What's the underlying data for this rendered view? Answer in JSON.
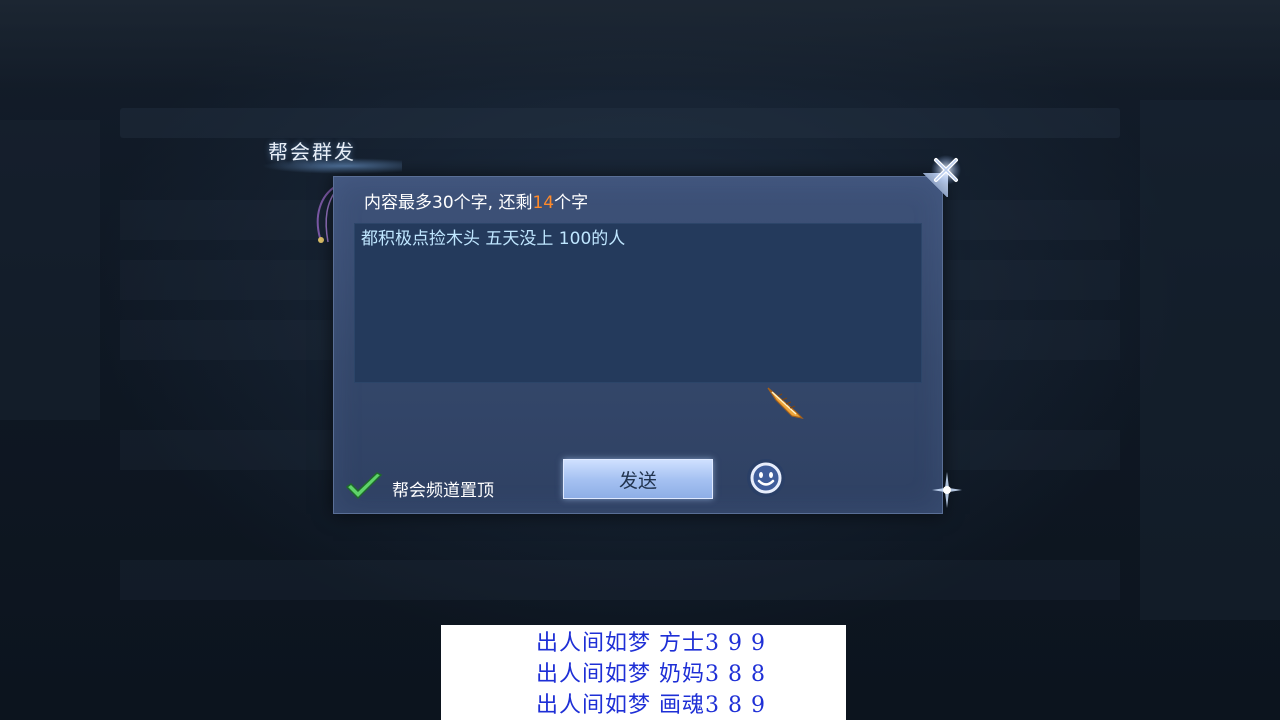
{
  "dialog": {
    "title": "帮会群发",
    "hint_prefix": "内容最多30个字, 还剩",
    "hint_count": "14",
    "hint_suffix": "个字",
    "message_text": "都积极点捡木头 五天没上 100的人",
    "pin_label": "帮会频道置顶",
    "pin_checked": true,
    "send_label": "发送"
  },
  "icons": {
    "close": "close-icon",
    "emoji": "smiley-icon",
    "cursor": "feather-cursor-icon",
    "check": "checkmark-icon"
  },
  "captions": [
    "出人间如梦  方士3 9 9",
    "出人间如梦  奶妈3 8 8",
    "出人间如梦  画魂3 8 9"
  ],
  "colors": {
    "count_highlight": "#ff8a2a",
    "message_text": "#bfe6ff",
    "caption_text": "#1e2fd6"
  }
}
